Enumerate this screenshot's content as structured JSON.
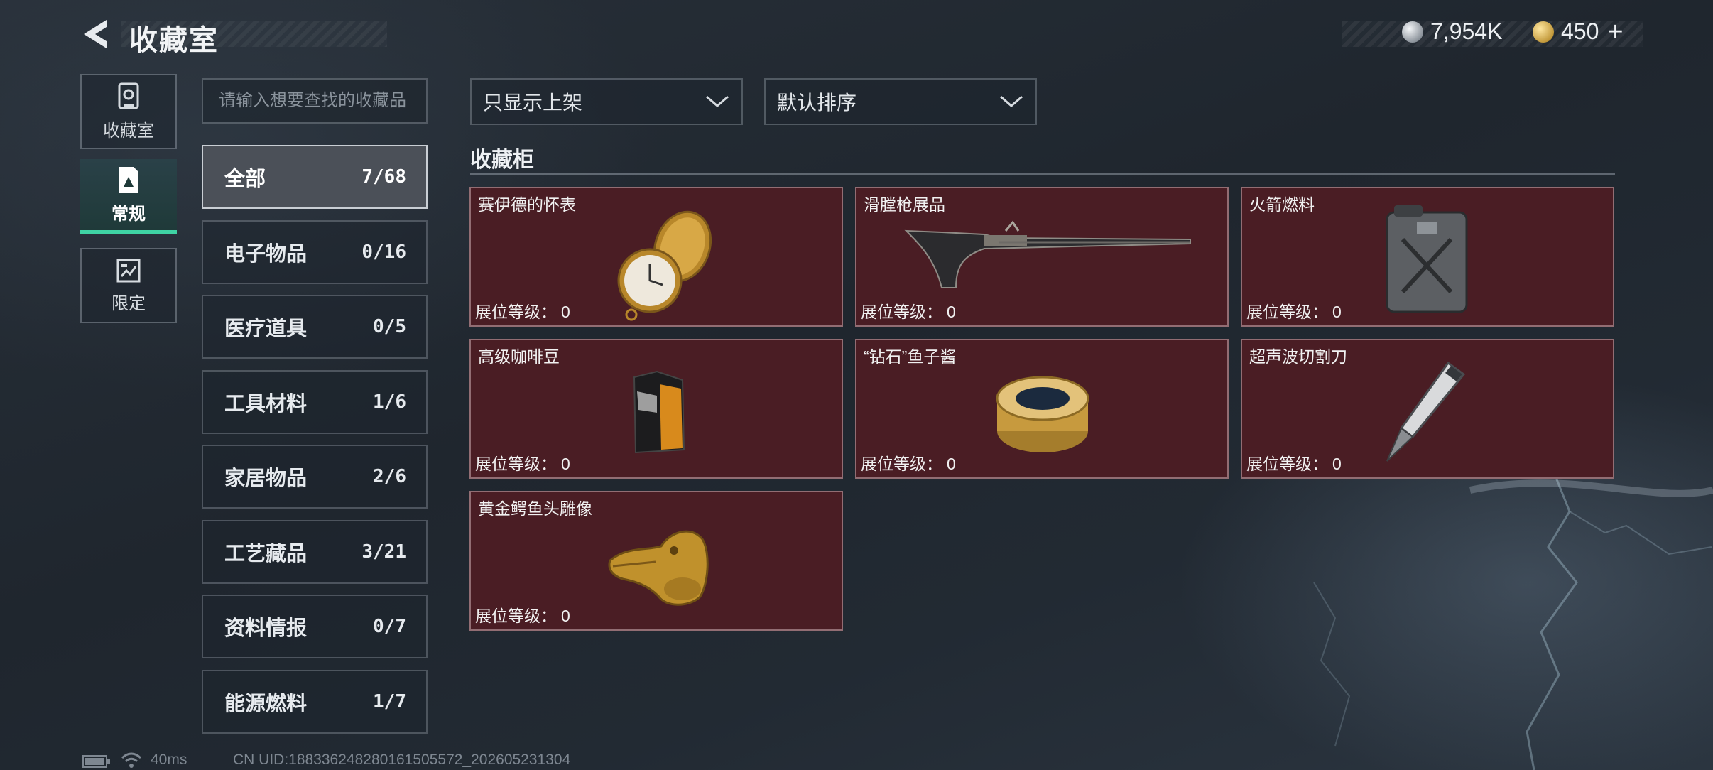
{
  "header": {
    "title": "收藏室",
    "back_icon": "back-arrow-icon",
    "currencies": [
      {
        "icon": "silver-coin-icon",
        "value": "7,954K"
      },
      {
        "icon": "gold-coin-icon",
        "value": "450",
        "add_label": "+"
      }
    ]
  },
  "nav": {
    "items": [
      {
        "label": "收藏室",
        "icon": "collection-room-icon",
        "active": false
      },
      {
        "label": "常规",
        "icon": "regular-card-icon",
        "active": true
      },
      {
        "label": "限定",
        "icon": "limited-card-icon",
        "active": false
      }
    ]
  },
  "search": {
    "placeholder": "请输入想要查找的收藏品"
  },
  "categories": [
    {
      "name": "全部",
      "count": "7/68",
      "active": true
    },
    {
      "name": "电子物品",
      "count": "0/16"
    },
    {
      "name": "医疗道具",
      "count": "0/5"
    },
    {
      "name": "工具材料",
      "count": "1/6"
    },
    {
      "name": "家居物品",
      "count": "2/6"
    },
    {
      "name": "工艺藏品",
      "count": "3/21"
    },
    {
      "name": "资料情报",
      "count": "0/7"
    },
    {
      "name": "能源燃料",
      "count": "1/7"
    }
  ],
  "filters": {
    "shelf_filter": "只显示上架",
    "sort": "默认排序"
  },
  "cabinet": {
    "title": "收藏柜",
    "level_label": "展位等级：",
    "items": [
      {
        "name": "赛伊德的怀表",
        "level": "0",
        "icon": "pocket-watch-icon"
      },
      {
        "name": "滑膛枪展品",
        "level": "0",
        "icon": "musket-icon"
      },
      {
        "name": "火箭燃料",
        "level": "0",
        "icon": "fuel-canister-icon"
      },
      {
        "name": "高级咖啡豆",
        "level": "0",
        "icon": "coffee-bag-icon"
      },
      {
        "name": "“钻石”鱼子酱",
        "level": "0",
        "icon": "caviar-tin-icon"
      },
      {
        "name": "超声波切割刀",
        "level": "0",
        "icon": "ultrasonic-knife-icon"
      },
      {
        "name": "黄金鳄鱼头雕像",
        "level": "0",
        "icon": "gold-crocodile-head-icon"
      }
    ]
  },
  "status": {
    "battery_icon": "battery-icon",
    "wifi_icon": "wifi-icon",
    "ping": "40ms",
    "uid": "CN UID:18833624828016150557​2_202605231304"
  },
  "colors": {
    "accent": "#3fd3a4",
    "card_bg": "#4a1d24",
    "active_category_bg": "#4b5058"
  }
}
